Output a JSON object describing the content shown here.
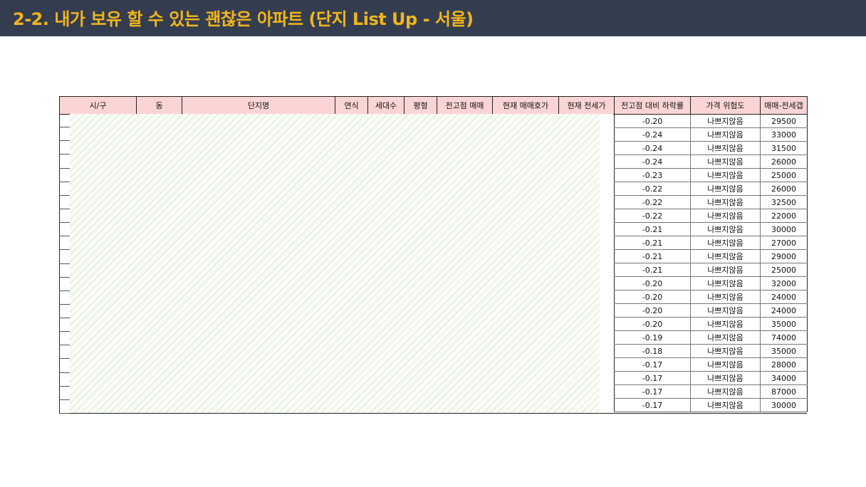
{
  "slide": {
    "title": "2-2. 내가 보유 할 수 있는 괜찮은 아파트 (단지 List Up - 서울)"
  },
  "table": {
    "headers": [
      "시/구",
      "동",
      "단지명",
      "연식",
      "세대수",
      "평형",
      "전고점 매매",
      "현재 매매호가",
      "현재 전세가",
      "전고점 대비 하락률",
      "가격 위험도",
      "매매-전세갭"
    ],
    "rows": [
      {
        "drop": "-0.20",
        "risk": "나쁘지않음",
        "gap": "29500"
      },
      {
        "drop": "-0.24",
        "risk": "나쁘지않음",
        "gap": "33000"
      },
      {
        "drop": "-0.24",
        "risk": "나쁘지않음",
        "gap": "31500"
      },
      {
        "drop": "-0.24",
        "risk": "나쁘지않음",
        "gap": "26000"
      },
      {
        "drop": "-0.23",
        "risk": "나쁘지않음",
        "gap": "25000"
      },
      {
        "drop": "-0.22",
        "risk": "나쁘지않음",
        "gap": "26000"
      },
      {
        "drop": "-0.22",
        "risk": "나쁘지않음",
        "gap": "32500"
      },
      {
        "drop": "-0.22",
        "risk": "나쁘지않음",
        "gap": "22000"
      },
      {
        "drop": "-0.21",
        "risk": "나쁘지않음",
        "gap": "30000"
      },
      {
        "drop": "-0.21",
        "risk": "나쁘지않음",
        "gap": "27000"
      },
      {
        "drop": "-0.21",
        "risk": "나쁘지않음",
        "gap": "29000"
      },
      {
        "drop": "-0.21",
        "risk": "나쁘지않음",
        "gap": "25000"
      },
      {
        "drop": "-0.20",
        "risk": "나쁘지않음",
        "gap": "32000"
      },
      {
        "drop": "-0.20",
        "risk": "나쁘지않음",
        "gap": "24000"
      },
      {
        "drop": "-0.20",
        "risk": "나쁘지않음",
        "gap": "24000"
      },
      {
        "drop": "-0.20",
        "risk": "나쁘지않음",
        "gap": "35000"
      },
      {
        "drop": "-0.19",
        "risk": "나쁘지않음",
        "gap": "74000"
      },
      {
        "drop": "-0.18",
        "risk": "나쁘지않음",
        "gap": "35000"
      },
      {
        "drop": "-0.17",
        "risk": "나쁘지않음",
        "gap": "28000"
      },
      {
        "drop": "-0.17",
        "risk": "나쁘지않음",
        "gap": "34000"
      },
      {
        "drop": "-0.17",
        "risk": "나쁘지않음",
        "gap": "87000"
      },
      {
        "drop": "-0.17",
        "risk": "나쁘지않음",
        "gap": "30000"
      }
    ]
  },
  "colors": {
    "title_bar": "#333d4f",
    "title_text": "#f2b51c",
    "header_fill": "#fbd5d5"
  }
}
